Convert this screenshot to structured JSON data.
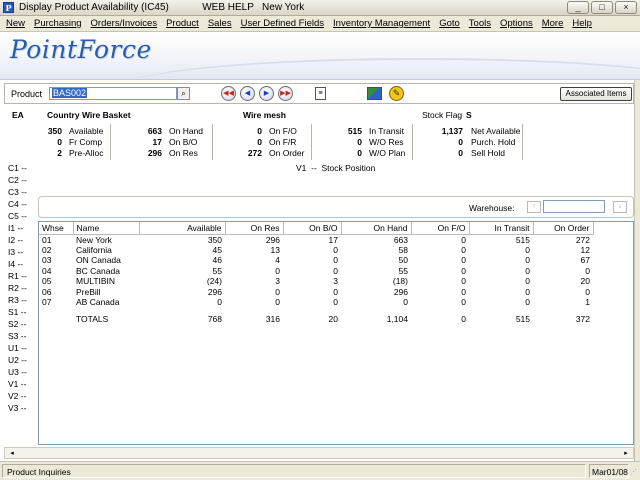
{
  "window": {
    "title": "Display Product Availability (IC45)            WEB HELP   New York",
    "controls": [
      "_",
      "□",
      "×"
    ]
  },
  "menu": [
    "New",
    "Purchasing",
    "Orders/Invoices",
    "Product",
    "Sales",
    "User Defined Fields",
    "Inventory Management",
    "Goto",
    "Tools",
    "Options",
    "More",
    "Help"
  ],
  "brand": {
    "logo": "PointForce"
  },
  "product_bar": {
    "label": "Product",
    "value": "BAS002",
    "search_icon": "⌕",
    "nav": [
      "◀◀",
      "◀",
      "▶",
      "▶▶"
    ],
    "notes_icon": "≡",
    "stamp_icon": "✎",
    "associated_items": "Associated Items"
  },
  "summary": {
    "uom": "EA",
    "description": "Country Wire Basket",
    "description2": "Wire mesh",
    "stock_flag_label": "Stock Flag",
    "stock_flag_value": "S",
    "groups": [
      {
        "rows": [
          [
            "350",
            "Available"
          ],
          [
            "0",
            "Fr Comp"
          ],
          [
            "2",
            "Pre-Alloc"
          ]
        ]
      },
      {
        "rows": [
          [
            "663",
            "On Hand"
          ],
          [
            "17",
            "On B/O"
          ],
          [
            "296",
            "On Res"
          ]
        ]
      },
      {
        "rows": [
          [
            "0",
            "On F/O"
          ],
          [
            "0",
            "On F/R"
          ],
          [
            "272",
            "On Order"
          ]
        ]
      },
      {
        "rows": [
          [
            "515",
            "In Transit"
          ],
          [
            "0",
            "W/O Res"
          ],
          [
            "0",
            "W/O Plan"
          ]
        ]
      },
      {
        "rows": [
          [
            "1,137",
            "Net Available"
          ],
          [
            "0",
            "Purch. Hold"
          ],
          [
            "0",
            "Sell Hold"
          ]
        ]
      }
    ]
  },
  "side_labels": [
    "C1 --",
    "C2 --",
    "C3 --",
    "C4 --",
    "C5 --",
    "I1 --",
    "I2 --",
    "I3 --",
    "I4 --",
    "R1 --",
    "R2 --",
    "R3 --",
    "S1 --",
    "S2 --",
    "S3 --",
    "U1 --",
    "U2 --",
    "U3 --",
    "V1 --",
    "V2 --",
    "V3 --"
  ],
  "view_title": "V1  --  Stock Position",
  "warehouse": {
    "label": "Warehouse:",
    "up": "↑",
    "down": "↓",
    "value": ""
  },
  "grid": {
    "columns": [
      "Whse",
      "Name",
      "Available",
      "On Res",
      "On B/O",
      "On Hand",
      "On F/O",
      "In Transit",
      "On Order"
    ],
    "rows": [
      [
        "01",
        "New York",
        "350",
        "296",
        "17",
        "663",
        "0",
        "515",
        "272"
      ],
      [
        "02",
        "California",
        "45",
        "13",
        "0",
        "58",
        "0",
        "0",
        "12"
      ],
      [
        "03",
        "ON Canada",
        "46",
        "4",
        "0",
        "50",
        "0",
        "0",
        "67"
      ],
      [
        "04",
        "BC Canada",
        "55",
        "0",
        "0",
        "55",
        "0",
        "0",
        "0"
      ],
      [
        "05",
        "MULTIBIN",
        "(24)",
        "3",
        "3",
        "(18)",
        "0",
        "0",
        "20"
      ],
      [
        "06",
        "PreBill",
        "296",
        "0",
        "0",
        "296",
        "0",
        "0",
        "0"
      ],
      [
        "07",
        "AB Canada",
        "0",
        "0",
        "0",
        "0",
        "0",
        "0",
        "1"
      ]
    ],
    "totals": [
      "",
      "TOTALS",
      "768",
      "316",
      "20",
      "1,104",
      "0",
      "515",
      "372"
    ]
  },
  "scroll": {
    "left": "◂",
    "right": "▸"
  },
  "status": {
    "left": "Product Inquiries",
    "right": "Mar01/08",
    "grip": "⋰"
  }
}
